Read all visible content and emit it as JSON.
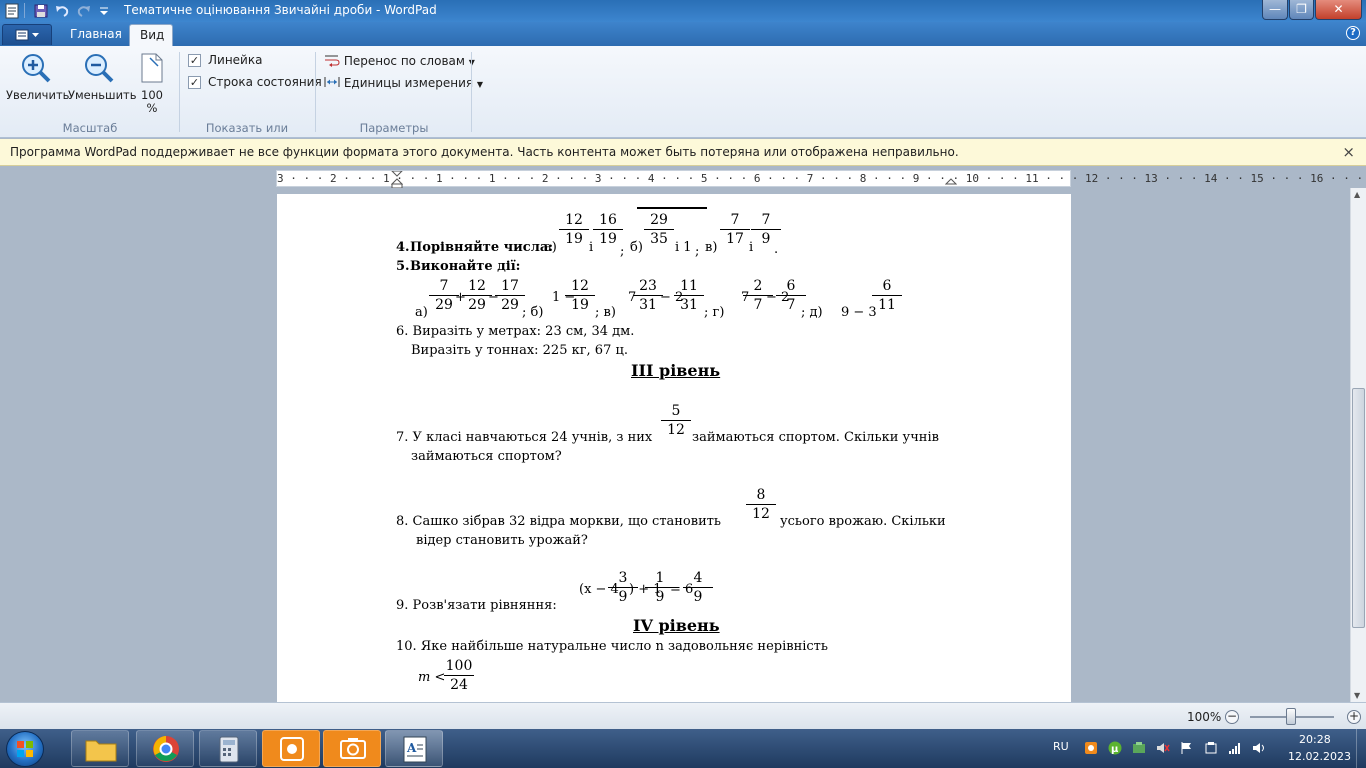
{
  "window": {
    "title": "Тематичне оцінювання Звичайні дроби - WordPad",
    "minimize": "—",
    "maximize": "❐",
    "close": "✕"
  },
  "tabs": {
    "home": "Главная",
    "view": "Вид",
    "help": "?"
  },
  "ribbon": {
    "zoom_in": "Увеличить",
    "zoom_out": "Уменьшить",
    "zoom_100": "100\n%",
    "group_scale": "Масштаб",
    "ruler_label": "Линейка",
    "statusbar_label": "Строка состояния",
    "group_show": "Показать или скрыть",
    "word_wrap": "Перенос по словам",
    "units": "Единицы измерения",
    "group_params": "Параметры"
  },
  "warning": {
    "message": "Программа WordPad поддерживает не все функции формата этого документа. Часть контента может быть потеряна или отображена неправильно.",
    "close": "×"
  },
  "ruler": {
    "numbers": "3 · · · 2 · · · 1 · · · 1 · · · 1 · · · 2 · · · 3 · · · 4 · · · 5 · · · 6 · · · 7 · · · 8 · · · 9 · · · 10 · · · 11 · · · 12 · · · 13 · · · 14 · · 15 · · · 16 · · · 17 · ·"
  },
  "document": {
    "q4_label": "4.",
    "q4_text": "Порівняйте числа:",
    "q4_a": "а)",
    "q4_and1": "і",
    "q4_semi1": ";",
    "q4_b": "б)",
    "q4_b_rest": "і 1",
    "q4_semi2": ";",
    "q4_v": "в)",
    "q4_and2": "і",
    "q4_dot": ".",
    "q5_label": "5.",
    "q5_text": "Виконайте дії:",
    "q5_a": "а)",
    "q5_b": "; б)",
    "q5_b_expr": "1 −",
    "q5_v": "; в)",
    "q5_v_whole1": "7",
    "q5_v_minus": "− 2",
    "q5_g": "; г)",
    "q5_g_whole1": "7",
    "q5_g_minus": "− 2",
    "q5_d": "; д)",
    "q5_d_expr": "9 − 3",
    "q6_line1": "6. Виразіть у метрах: 23 см, 34 дм.",
    "q6_line2": "Виразіть у тоннах: 225 кг, 67 ц.",
    "level3": "ІІІ рівень",
    "q7_line1a": "7.  У класі навчаються 24 учнів, з них",
    "q7_line1b": "займаються   спортом.   Скільки учнів",
    "q7_line2": "займаються спортом?",
    "q8_line1a": "8.   Сашко  зібрав  32  відра  моркви,  що  становить",
    "q8_line1b": "усього  врожаю.  Скільки",
    "q8_line2": "відер становить урожай?",
    "q9_label": "9. Розв'язати рівняння:",
    "q9_eq_left": "(x − 4",
    "q9_eq_mid": ") + 1",
    "q9_eq_eq": "= 6",
    "level4": "IV рівень",
    "q10_line1": "10. Яке найбільше натуральне число n задовольняє нерівність",
    "q10_ineq": "m <",
    "fractions": {
      "f1": {
        "n": "12",
        "d": "19"
      },
      "f2": {
        "n": "16",
        "d": "19"
      },
      "f3": {
        "n": "29",
        "d": "35"
      },
      "f4": {
        "n": "7",
        "d": "17"
      },
      "f5": {
        "n": "7",
        "d": "9"
      },
      "f6": {
        "n": "7",
        "d": "29"
      },
      "f7": {
        "n": "12",
        "d": "29"
      },
      "f8": {
        "n": "17",
        "d": "29"
      },
      "f9": {
        "n": "12",
        "d": "19"
      },
      "f10": {
        "n": "23",
        "d": "31"
      },
      "f11": {
        "n": "11",
        "d": "31"
      },
      "f12": {
        "n": "2",
        "d": "7"
      },
      "f13": {
        "n": "6",
        "d": "7"
      },
      "f14": {
        "n": "6",
        "d": "11"
      },
      "f15": {
        "n": "5",
        "d": "12"
      },
      "f16": {
        "n": "8",
        "d": "12"
      },
      "f17": {
        "n": "3",
        "d": "9"
      },
      "f18": {
        "n": "1",
        "d": "9"
      },
      "f19": {
        "n": "4",
        "d": "9"
      },
      "f20": {
        "n": "100",
        "d": "24"
      }
    }
  },
  "status": {
    "zoom": "100%",
    "zoom_minus": "−",
    "zoom_plus": "+"
  },
  "taskbar": {
    "lang": "RU",
    "time": "20:28",
    "date": "12.02.2023"
  }
}
